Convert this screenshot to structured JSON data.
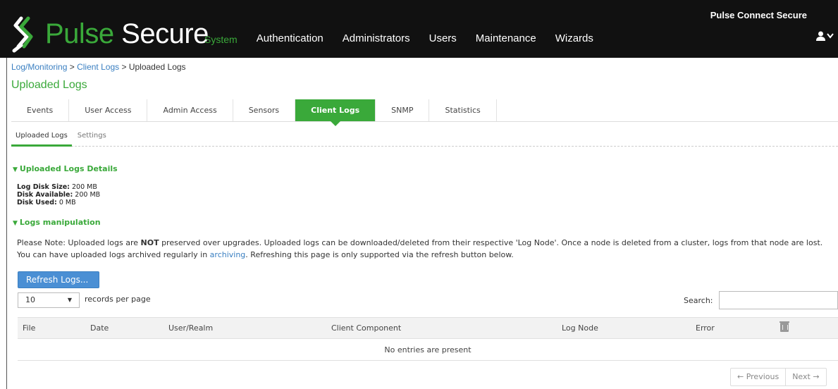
{
  "header": {
    "brand": "Pulse Secure",
    "brand_part1": "Pulse",
    "brand_part2": " Secure",
    "product_name": "Pulse Connect Secure",
    "nav": [
      "System",
      "Authentication",
      "Administrators",
      "Users",
      "Maintenance",
      "Wizards"
    ],
    "active_nav": "System",
    "user_icon": "user-icon"
  },
  "breadcrumb": {
    "item1": "Log/Monitoring",
    "sep": " > ",
    "item2": "Client Logs",
    "item3": "Uploaded Logs"
  },
  "page_title": "Uploaded Logs",
  "tabs": [
    "Events",
    "User Access",
    "Admin Access",
    "Sensors",
    "Client Logs",
    "SNMP",
    "Statistics"
  ],
  "active_tab": "Client Logs",
  "subtabs": [
    "Uploaded Logs",
    "Settings"
  ],
  "active_subtab": "Uploaded Logs",
  "details": {
    "heading": "Uploaded Logs Details",
    "disk_size_label": "Log Disk Size:",
    "disk_size_value": " 200 MB",
    "disk_available_label": "Disk Available:",
    "disk_available_value": " 200 MB",
    "disk_used_label": "Disk Used:",
    "disk_used_value": " 0 MB"
  },
  "manipulation": {
    "heading": "Logs manipulation",
    "note_part1": "Please Note: Uploaded logs are ",
    "note_bold": "NOT",
    "note_part2": " preserved over upgrades. Uploaded logs can be downloaded/deleted from their respective 'Log Node'. Once a node is deleted from a cluster, logs from that node are lost. You can have uploaded logs archived regularly in ",
    "note_link": "archiving",
    "note_part3": ". Refreshing this page is only supported via the refresh button below."
  },
  "refresh_button": "Refresh Logs...",
  "records_per_page": {
    "value": "10",
    "label": "records per page"
  },
  "search": {
    "label": "Search:",
    "value": ""
  },
  "table": {
    "columns": [
      "File",
      "Date",
      "User/Realm",
      "Client Component",
      "Log Node",
      "Error"
    ],
    "empty_message": "No entries are present"
  },
  "pager": {
    "previous": "← Previous",
    "next": "Next →"
  },
  "colors": {
    "accent_green": "#3aa93a",
    "link_blue": "#3a7fc1",
    "header_bg": "#111111"
  }
}
